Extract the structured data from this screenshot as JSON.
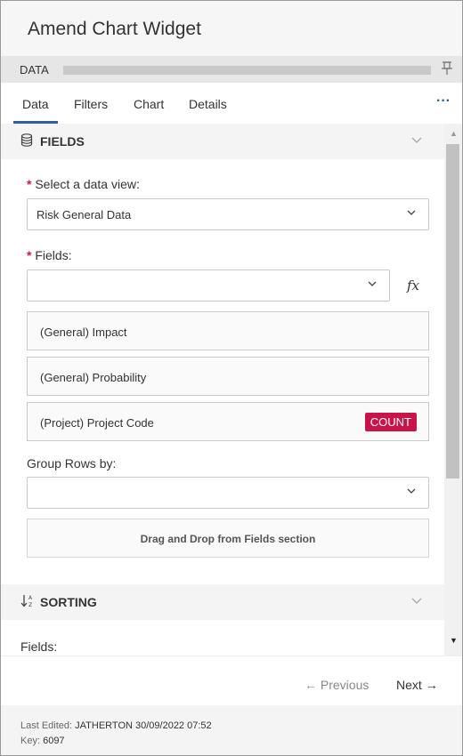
{
  "header": {
    "title": "Amend Chart Widget"
  },
  "data_bar": {
    "label": "DATA",
    "progress_fraction": 1.0,
    "pin_icon": "pin-icon"
  },
  "tabs": [
    {
      "label": "Data",
      "active": true
    },
    {
      "label": "Filters",
      "active": false
    },
    {
      "label": "Chart",
      "active": false
    },
    {
      "label": "Details",
      "active": false
    }
  ],
  "more_label": "···",
  "fields_section": {
    "icon": "database-icon",
    "title": "FIELDS",
    "required_mark": "*",
    "data_view_label": "Select a data view:",
    "data_view_value": "Risk General Data",
    "fields_label": "Fields:",
    "fields_value": "",
    "fx_label": "fx",
    "items": [
      {
        "label": "(General) Impact",
        "badge": ""
      },
      {
        "label": "(General) Probability",
        "badge": ""
      },
      {
        "label": "(Project) Project Code",
        "badge": "COUNT"
      }
    ],
    "group_rows_label": "Group Rows by:",
    "group_rows_value": "",
    "drop_zone_text": "Drag and Drop from Fields section"
  },
  "sorting_section": {
    "icon": "sort-icon",
    "title": "SORTING",
    "fields_label": "Fields:"
  },
  "nav": {
    "previous": "Previous",
    "next": "Next"
  },
  "meta": {
    "last_edited_label": "Last Edited:",
    "last_edited_value": "JATHERTON 30/09/2022 07:52",
    "key_label": "Key:",
    "key_value": "6097"
  },
  "colors": {
    "accent": "#2e5e9e",
    "required": "#d0173e",
    "badge": "#c8144a"
  }
}
